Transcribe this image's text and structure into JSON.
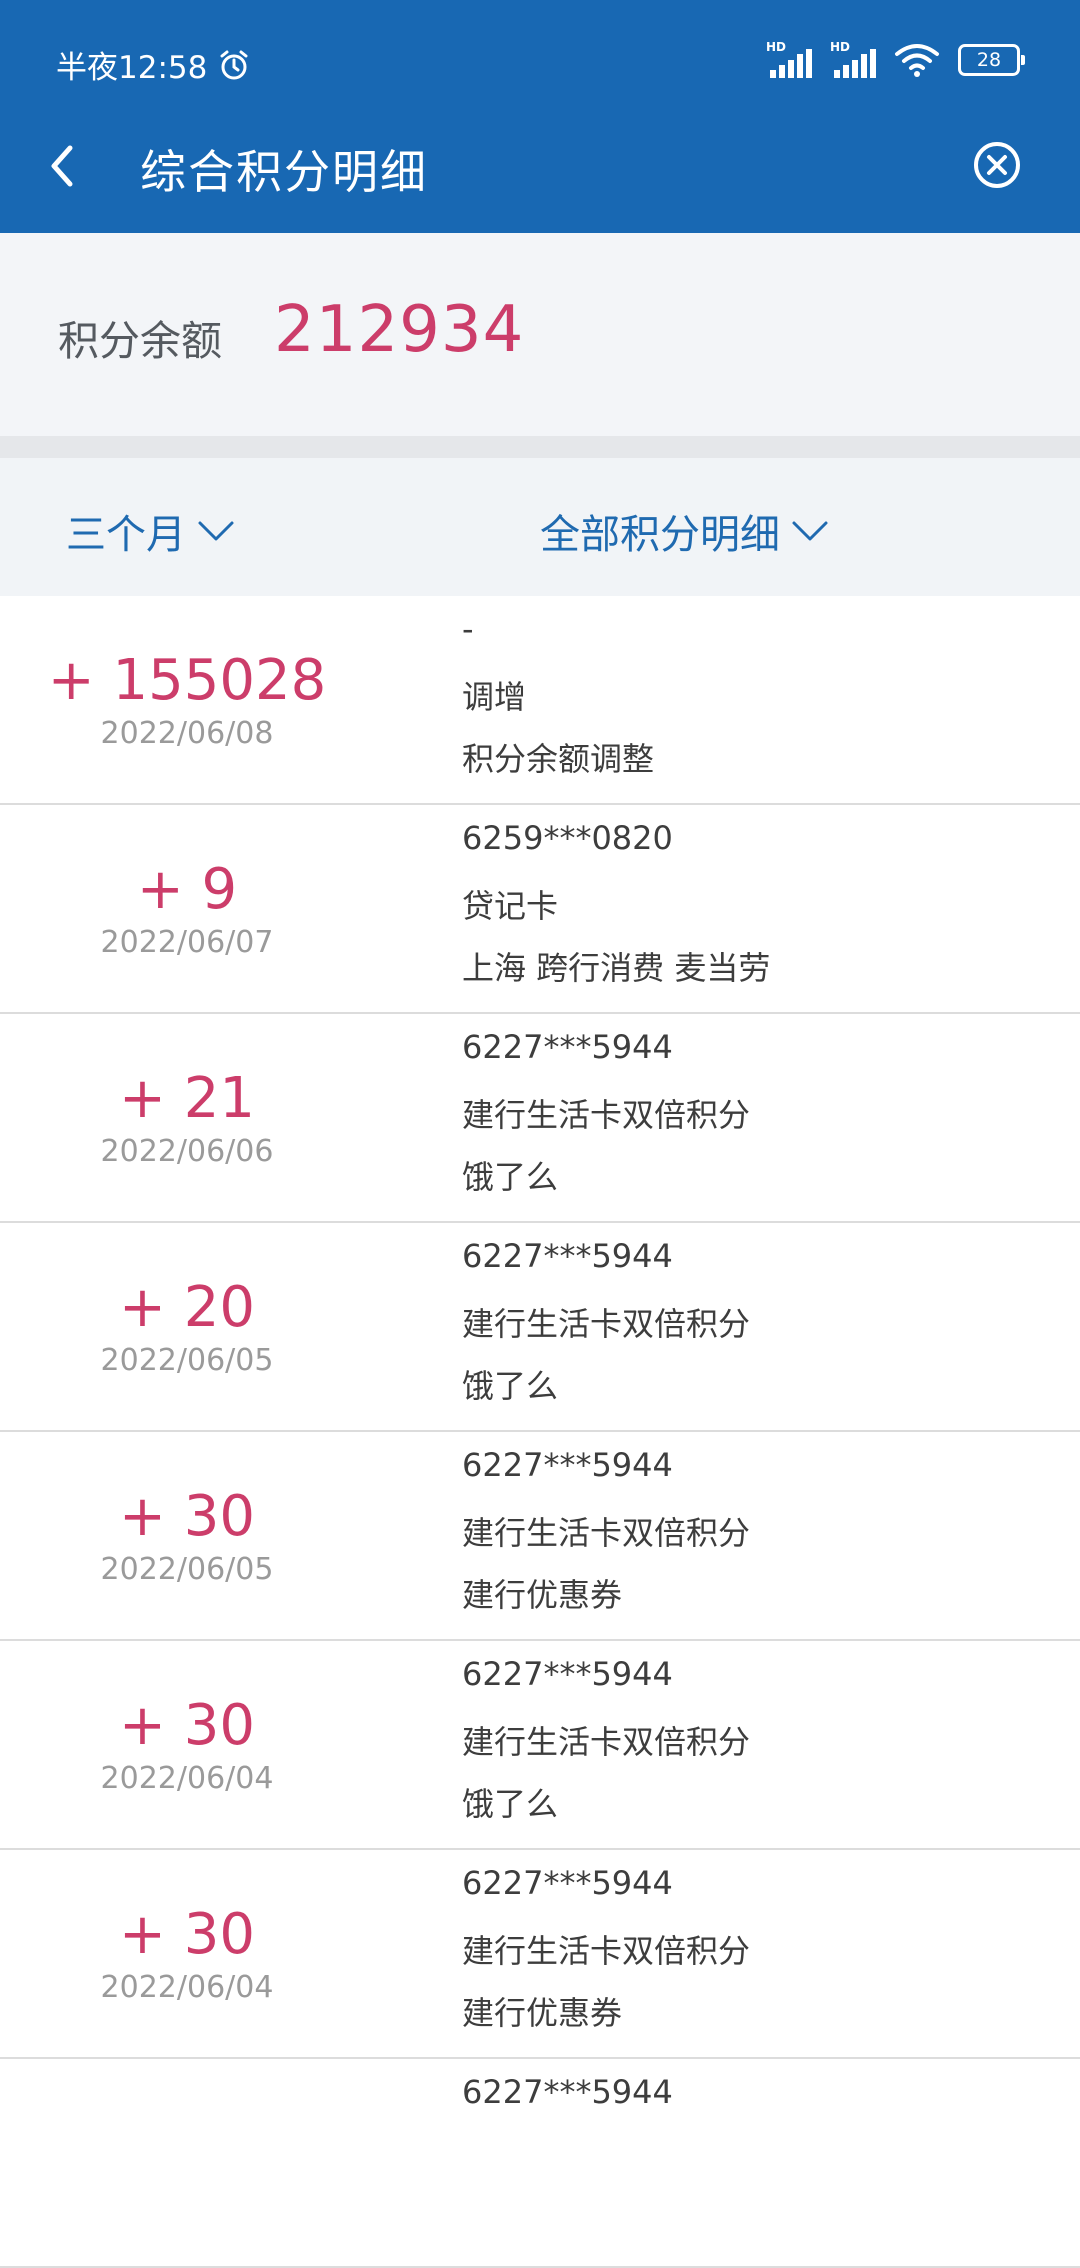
{
  "status_bar": {
    "time": "半夜12:58",
    "battery": "28",
    "signal_label": "HD"
  },
  "header": {
    "title": "综合积分明细"
  },
  "balance": {
    "label": "积分余额",
    "value": "212934"
  },
  "filters": {
    "period": "三个月",
    "type": "全部积分明细"
  },
  "records": [
    {
      "amount": "+ 155028",
      "date": "2022/06/08",
      "line1": "-",
      "line2": "调增",
      "line3": "积分余额调整"
    },
    {
      "amount": "+ 9",
      "date": "2022/06/07",
      "line1": "6259***0820",
      "line2": "贷记卡",
      "line3": "上海 跨行消费 麦当劳"
    },
    {
      "amount": "+ 21",
      "date": "2022/06/06",
      "line1": "6227***5944",
      "line2": "建行生活卡双倍积分",
      "line3": "饿了么"
    },
    {
      "amount": "+ 20",
      "date": "2022/06/05",
      "line1": "6227***5944",
      "line2": "建行生活卡双倍积分",
      "line3": "饿了么"
    },
    {
      "amount": "+ 30",
      "date": "2022/06/05",
      "line1": "6227***5944",
      "line2": "建行生活卡双倍积分",
      "line3": "建行优惠券"
    },
    {
      "amount": "+ 30",
      "date": "2022/06/04",
      "line1": "6227***5944",
      "line2": "建行生活卡双倍积分",
      "line3": "饿了么"
    },
    {
      "amount": "+ 30",
      "date": "2022/06/04",
      "line1": "6227***5944",
      "line2": "建行生活卡双倍积分",
      "line3": "建行优惠券"
    },
    {
      "amount": "",
      "date": "",
      "line1": "6227***5944",
      "line2": "",
      "line3": ""
    }
  ],
  "colors": {
    "header_bg": "#1868b3",
    "accent_points": "#cc3d6a",
    "filter_text": "#1f6ab0"
  }
}
